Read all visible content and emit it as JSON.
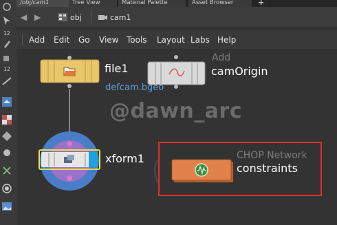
{
  "tabs": [
    "/obj/cam1",
    "Tree View",
    "Material Palette",
    "Asset Browser"
  ],
  "tab_add": "+",
  "toolbar_numbers": [
    "12",
    "12"
  ],
  "path": {
    "back": "◀",
    "forward": "▶",
    "context": "obj",
    "node": "cam1"
  },
  "menu": [
    "Add",
    "Edit",
    "Go",
    "View",
    "Tools",
    "Layout",
    "Labs",
    "Help"
  ],
  "nodes": {
    "file1": {
      "name": "file1",
      "subtitle": "defcam.bgeo"
    },
    "camOrigin": {
      "type": "Add",
      "name": "camOrigin"
    },
    "xform1": {
      "name": "xform1"
    },
    "constraints": {
      "type": "CHOP Network",
      "name": "constraints"
    }
  },
  "watermark": "@dawn_arc",
  "colors": {
    "file_node": "#e8c76a",
    "xform_ring": "#4a7cc7",
    "chop_node": "#e0824a",
    "highlight_box": "#e03030",
    "subtitle_blue": "#5f9fe0"
  },
  "icons": {
    "file1": "folder-icon",
    "camOrigin": "curve-icon",
    "xform1": "transform-icon",
    "constraints": "waveform-icon"
  }
}
